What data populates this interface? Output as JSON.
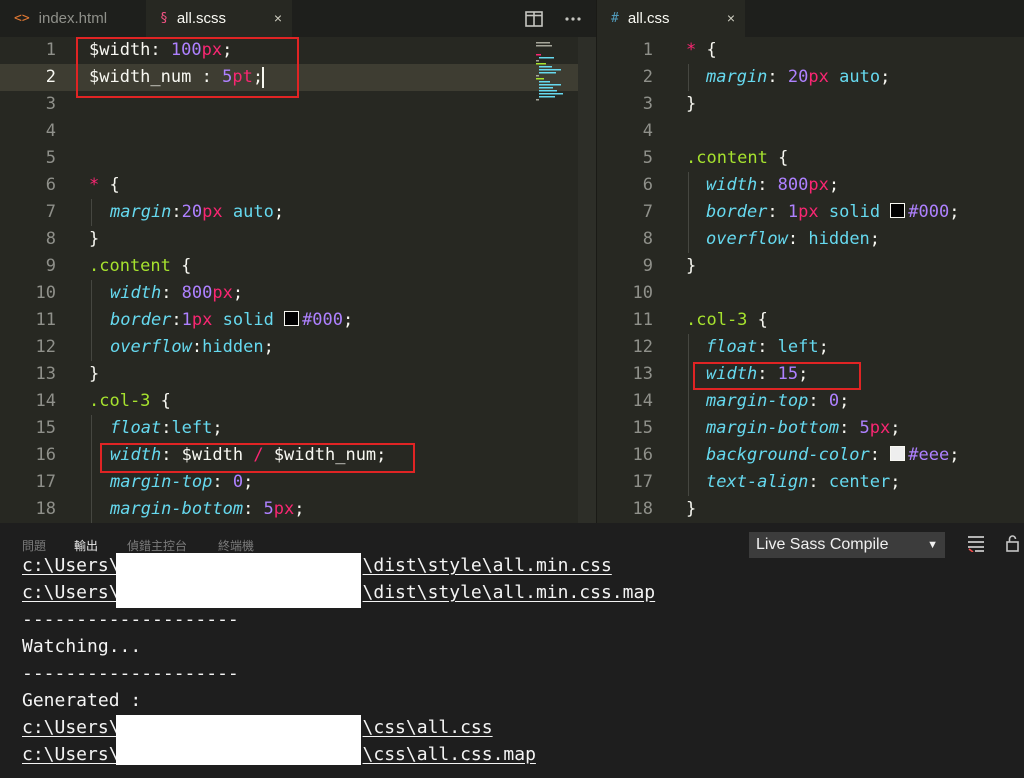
{
  "left_editor": {
    "tabs": [
      {
        "icon": "<>",
        "label": "index.html"
      },
      {
        "icon": "§",
        "label": "all.scss",
        "close": "×"
      }
    ],
    "lines": [
      {
        "n": "1",
        "indent": 0,
        "tokens": [
          [
            "t-var",
            "$width"
          ],
          [
            "t-punc",
            ": "
          ],
          [
            "t-num",
            "100"
          ],
          [
            "t-unit",
            "px"
          ],
          [
            "t-punc",
            ";"
          ]
        ]
      },
      {
        "n": "2",
        "indent": 0,
        "current": true,
        "tokens": [
          [
            "t-var",
            "$width_num"
          ],
          [
            "t-punc",
            " : "
          ],
          [
            "t-num",
            "5"
          ],
          [
            "t-unit",
            "pt"
          ],
          [
            "t-punc",
            ";"
          ]
        ]
      },
      {
        "n": "3",
        "indent": 0,
        "tokens": []
      },
      {
        "n": "4",
        "indent": 0,
        "tokens": []
      },
      {
        "n": "5",
        "indent": 0,
        "tokens": []
      },
      {
        "n": "6",
        "indent": 0,
        "tokens": [
          [
            "t-op",
            "*"
          ],
          [
            "t-punc",
            " {"
          ]
        ]
      },
      {
        "n": "7",
        "indent": 1,
        "tokens": [
          [
            "t-prop",
            "margin"
          ],
          [
            "t-punc",
            ":"
          ],
          [
            "t-num",
            "20"
          ],
          [
            "t-unit",
            "px"
          ],
          [
            "t-val",
            " auto"
          ],
          [
            "t-punc",
            ";"
          ]
        ]
      },
      {
        "n": "8",
        "indent": 0,
        "tokens": [
          [
            "t-punc",
            "}"
          ]
        ]
      },
      {
        "n": "9",
        "indent": 0,
        "tokens": [
          [
            "t-sel",
            ".content"
          ],
          [
            "t-punc",
            " {"
          ]
        ]
      },
      {
        "n": "10",
        "indent": 1,
        "tokens": [
          [
            "t-prop",
            "width"
          ],
          [
            "t-punc",
            ": "
          ],
          [
            "t-num",
            "800"
          ],
          [
            "t-unit",
            "px"
          ],
          [
            "t-punc",
            ";"
          ]
        ]
      },
      {
        "n": "11",
        "indent": 1,
        "tokens": [
          [
            "t-prop",
            "border"
          ],
          [
            "t-punc",
            ":"
          ],
          [
            "t-num",
            "1"
          ],
          [
            "t-unit",
            "px"
          ],
          [
            "t-val",
            " solid "
          ],
          [
            "swatch",
            "#000000"
          ],
          [
            "t-num",
            "#000"
          ],
          [
            "t-punc",
            ";"
          ]
        ]
      },
      {
        "n": "12",
        "indent": 1,
        "tokens": [
          [
            "t-prop",
            "overflow"
          ],
          [
            "t-punc",
            ":"
          ],
          [
            "t-val",
            "hidden"
          ],
          [
            "t-punc",
            ";"
          ]
        ]
      },
      {
        "n": "13",
        "indent": 0,
        "tokens": [
          [
            "t-punc",
            "}"
          ]
        ]
      },
      {
        "n": "14",
        "indent": 0,
        "tokens": [
          [
            "t-sel",
            ".col-3"
          ],
          [
            "t-punc",
            " {"
          ]
        ]
      },
      {
        "n": "15",
        "indent": 1,
        "tokens": [
          [
            "t-prop",
            "float"
          ],
          [
            "t-punc",
            ":"
          ],
          [
            "t-val",
            "left"
          ],
          [
            "t-punc",
            ";"
          ]
        ]
      },
      {
        "n": "16",
        "indent": 1,
        "tokens": [
          [
            "t-prop",
            "width"
          ],
          [
            "t-punc",
            ": "
          ],
          [
            "t-var",
            "$width"
          ],
          [
            "t-op",
            " / "
          ],
          [
            "t-var",
            "$width_num"
          ],
          [
            "t-punc",
            ";"
          ]
        ]
      },
      {
        "n": "17",
        "indent": 1,
        "tokens": [
          [
            "t-prop",
            "margin-top"
          ],
          [
            "t-punc",
            ": "
          ],
          [
            "t-num",
            "0"
          ],
          [
            "t-punc",
            ";"
          ]
        ]
      },
      {
        "n": "18",
        "indent": 1,
        "tokens": [
          [
            "t-prop",
            "margin-bottom"
          ],
          [
            "t-punc",
            ": "
          ],
          [
            "t-num",
            "5"
          ],
          [
            "t-unit",
            "px"
          ],
          [
            "t-punc",
            ";"
          ]
        ]
      }
    ]
  },
  "right_editor": {
    "tabs": [
      {
        "icon": "#",
        "label": "all.css",
        "close": "×"
      }
    ],
    "lines": [
      {
        "n": "1",
        "indent": 0,
        "tokens": [
          [
            "t-op",
            "*"
          ],
          [
            "t-punc",
            " {"
          ]
        ]
      },
      {
        "n": "2",
        "indent": 1,
        "tokens": [
          [
            "t-prop",
            "margin"
          ],
          [
            "t-punc",
            ": "
          ],
          [
            "t-num",
            "20"
          ],
          [
            "t-unit",
            "px"
          ],
          [
            "t-val",
            " auto"
          ],
          [
            "t-punc",
            ";"
          ]
        ]
      },
      {
        "n": "3",
        "indent": 0,
        "tokens": [
          [
            "t-punc",
            "}"
          ]
        ]
      },
      {
        "n": "4",
        "indent": 0,
        "tokens": []
      },
      {
        "n": "5",
        "indent": 0,
        "tokens": [
          [
            "t-sel",
            ".content"
          ],
          [
            "t-punc",
            " {"
          ]
        ]
      },
      {
        "n": "6",
        "indent": 1,
        "tokens": [
          [
            "t-prop",
            "width"
          ],
          [
            "t-punc",
            ": "
          ],
          [
            "t-num",
            "800"
          ],
          [
            "t-unit",
            "px"
          ],
          [
            "t-punc",
            ";"
          ]
        ]
      },
      {
        "n": "7",
        "indent": 1,
        "tokens": [
          [
            "t-prop",
            "border"
          ],
          [
            "t-punc",
            ": "
          ],
          [
            "t-num",
            "1"
          ],
          [
            "t-unit",
            "px"
          ],
          [
            "t-val",
            " solid "
          ],
          [
            "swatch",
            "#000000"
          ],
          [
            "t-num",
            "#000"
          ],
          [
            "t-punc",
            ";"
          ]
        ]
      },
      {
        "n": "8",
        "indent": 1,
        "tokens": [
          [
            "t-prop",
            "overflow"
          ],
          [
            "t-punc",
            ": "
          ],
          [
            "t-val",
            "hidden"
          ],
          [
            "t-punc",
            ";"
          ]
        ]
      },
      {
        "n": "9",
        "indent": 0,
        "tokens": [
          [
            "t-punc",
            "}"
          ]
        ]
      },
      {
        "n": "10",
        "indent": 0,
        "tokens": []
      },
      {
        "n": "11",
        "indent": 0,
        "tokens": [
          [
            "t-sel",
            ".col-3"
          ],
          [
            "t-punc",
            " {"
          ]
        ]
      },
      {
        "n": "12",
        "indent": 1,
        "tokens": [
          [
            "t-prop",
            "float"
          ],
          [
            "t-punc",
            ": "
          ],
          [
            "t-val",
            "left"
          ],
          [
            "t-punc",
            ";"
          ]
        ]
      },
      {
        "n": "13",
        "indent": 1,
        "tokens": [
          [
            "t-prop",
            "width"
          ],
          [
            "t-punc",
            ": "
          ],
          [
            "t-num",
            "15"
          ],
          [
            "t-punc",
            ";"
          ]
        ]
      },
      {
        "n": "14",
        "indent": 1,
        "tokens": [
          [
            "t-prop",
            "margin-top"
          ],
          [
            "t-punc",
            ": "
          ],
          [
            "t-num",
            "0"
          ],
          [
            "t-punc",
            ";"
          ]
        ]
      },
      {
        "n": "15",
        "indent": 1,
        "tokens": [
          [
            "t-prop",
            "margin-bottom"
          ],
          [
            "t-punc",
            ": "
          ],
          [
            "t-num",
            "5"
          ],
          [
            "t-unit",
            "px"
          ],
          [
            "t-punc",
            ";"
          ]
        ]
      },
      {
        "n": "16",
        "indent": 1,
        "tokens": [
          [
            "t-prop",
            "background-color"
          ],
          [
            "t-punc",
            ": "
          ],
          [
            "swatch",
            "#eeeeee"
          ],
          [
            "t-num",
            "#eee"
          ],
          [
            "t-punc",
            ";"
          ]
        ]
      },
      {
        "n": "17",
        "indent": 1,
        "tokens": [
          [
            "t-prop",
            "text-align"
          ],
          [
            "t-punc",
            ": "
          ],
          [
            "t-val",
            "center"
          ],
          [
            "t-punc",
            ";"
          ]
        ]
      },
      {
        "n": "18",
        "indent": 0,
        "tokens": [
          [
            "t-punc",
            "}"
          ]
        ]
      }
    ]
  },
  "panel": {
    "tabs": [
      "問題",
      "輸出",
      "偵錯主控台",
      "終端機"
    ],
    "active_tab": "輸出",
    "dropdown": "Live Sass Compile",
    "dropdown_arrow": "▼",
    "output_lines": [
      {
        "pre": "c:\\Users\\",
        "post": "\\dist\\style\\all.min.css",
        "underline": true
      },
      {
        "pre": "c:\\Users\\",
        "post": "\\dist\\style\\all.min.css.map",
        "underline": true
      },
      {
        "text": "--------------------"
      },
      {
        "text": "Watching..."
      },
      {
        "text": "--------------------"
      },
      {
        "text": "Generated :"
      },
      {
        "pre": "c:\\Users\\",
        "post": "\\css\\all.css",
        "underline": true
      },
      {
        "pre": "c:\\Users\\",
        "post": "\\css\\all.css.map",
        "underline": true
      }
    ]
  },
  "icons": {
    "split": "split-editor-icon",
    "more": "more-actions-icon",
    "clear": "clear-output-icon",
    "lock": "lock-scroll-icon"
  }
}
